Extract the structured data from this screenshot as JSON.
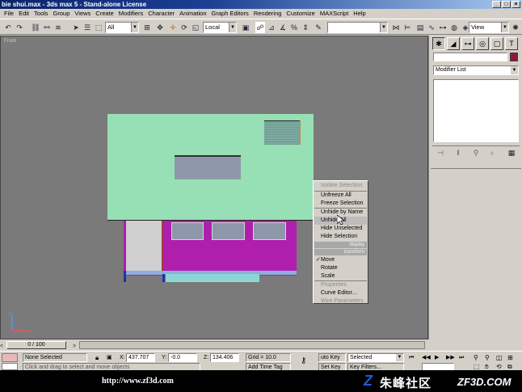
{
  "window": {
    "title": "bie shui.max - 3ds max 5 - Stand-alone License"
  },
  "menu": [
    "File",
    "Edit",
    "Tools",
    "Group",
    "Views",
    "Create",
    "Modifiers",
    "Character",
    "Animation",
    "Graph Editors",
    "Rendering",
    "Customize",
    "MAXScript",
    "Help"
  ],
  "toolbar": {
    "filter_value": "All",
    "coord_value": "Local",
    "view_value": "View"
  },
  "viewport": {
    "label": "Front"
  },
  "context_menu": {
    "top_items": [
      "Isolate Selection",
      "Unfreeze All",
      "Freeze Selection",
      "Unhide by Name",
      "Unhide All",
      "Hide Unselected",
      "Hide Selection"
    ],
    "display_header": "display",
    "transform_header": "transform",
    "bottom_items": [
      "Move",
      "Rotate",
      "Scale",
      "Properties",
      "Curve Editor...",
      "Wire Parameters"
    ],
    "checked_item": "Move"
  },
  "command_panel": {
    "modifier_list": "Modifier List",
    "object_color": "#8c1840"
  },
  "timeline": {
    "frame_label": "0 / 100"
  },
  "status": {
    "selection": "None Selected",
    "prompt": "Click and drag to select and move objects",
    "x_label": "X:",
    "x_value": "437.707",
    "y_label": "Y:",
    "y_value": "-0.0",
    "z_label": "Z:",
    "z_value": "134.406",
    "grid": "Grid = 10.0",
    "add_time_tag": "Add Time Tag",
    "auto_key": "uto Key",
    "set_key": "Set Key",
    "key_mode": "Selected",
    "key_filters": "Key Filters..."
  },
  "banner": {
    "url": "http://www.zf3d.com",
    "brand_cn": "朱峰社区",
    "brand_logo": "ZF3D.COM"
  }
}
